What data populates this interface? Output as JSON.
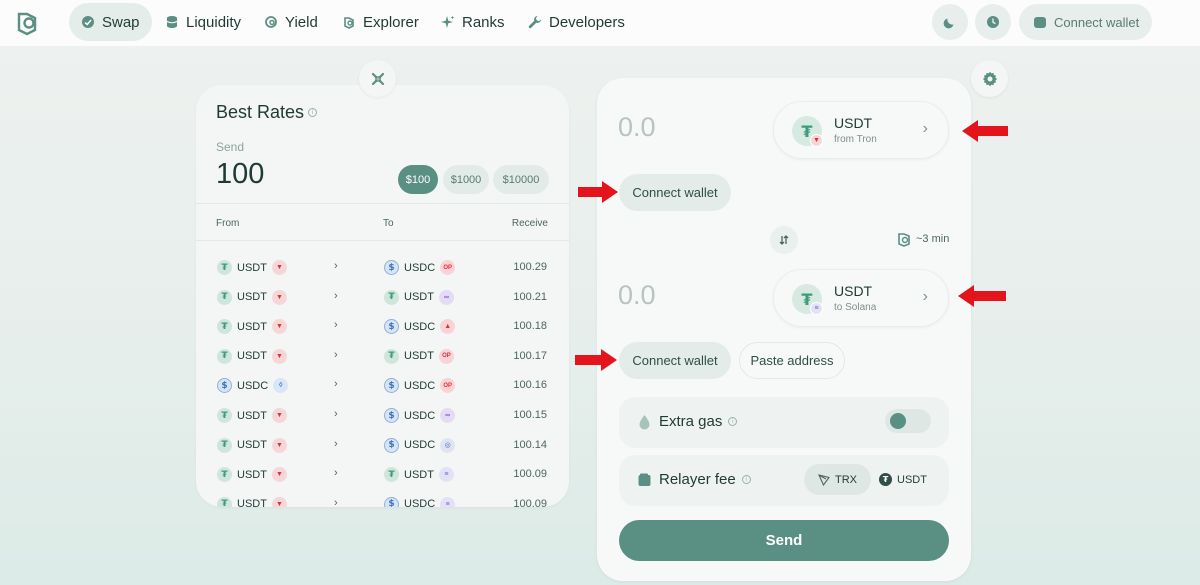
{
  "nav": {
    "items": [
      {
        "label": "Swap",
        "icon": "swap-icon"
      },
      {
        "label": "Liquidity",
        "icon": "database-icon"
      },
      {
        "label": "Yield",
        "icon": "yield-icon"
      },
      {
        "label": "Explorer",
        "icon": "explorer-icon"
      },
      {
        "label": "Ranks",
        "icon": "sparkle-icon"
      },
      {
        "label": "Developers",
        "icon": "wrench-icon"
      }
    ],
    "connect_wallet": "Connect wallet"
  },
  "rates": {
    "title": "Best Rates",
    "send_label": "Send",
    "send_amount": "100",
    "presets": [
      "$100",
      "$1000",
      "$10000"
    ],
    "columns": {
      "from": "From",
      "to": "To",
      "receive": "Receive"
    },
    "rows": [
      {
        "from": "USDT",
        "from_chain": "tron",
        "to": "USDC",
        "to_chain": "op",
        "receive": "100.29"
      },
      {
        "from": "USDT",
        "from_chain": "tron",
        "to": "USDT",
        "to_chain": "poly",
        "receive": "100.21"
      },
      {
        "from": "USDT",
        "from_chain": "tron",
        "to": "USDC",
        "to_chain": "avax",
        "receive": "100.18"
      },
      {
        "from": "USDT",
        "from_chain": "tron",
        "to": "USDT",
        "to_chain": "op",
        "receive": "100.17"
      },
      {
        "from": "USDC",
        "from_chain": "base",
        "to": "USDC",
        "to_chain": "op",
        "receive": "100.16"
      },
      {
        "from": "USDT",
        "from_chain": "tron",
        "to": "USDC",
        "to_chain": "poly",
        "receive": "100.15"
      },
      {
        "from": "USDT",
        "from_chain": "tron",
        "to": "USDC",
        "to_chain": "eth",
        "receive": "100.14"
      },
      {
        "from": "USDT",
        "from_chain": "tron",
        "to": "USDT",
        "to_chain": "sol",
        "receive": "100.09"
      },
      {
        "from": "USDT",
        "from_chain": "tron",
        "to": "USDC",
        "to_chain": "sol",
        "receive": "100.09"
      }
    ]
  },
  "swap": {
    "from_amount": "0.0",
    "from_token": {
      "symbol": "USDT",
      "sub": "from Tron"
    },
    "from_connect": "Connect wallet",
    "eta": "~3 min",
    "to_amount": "0.0",
    "to_token": {
      "symbol": "USDT",
      "sub": "to Solana"
    },
    "to_connect": "Connect wallet",
    "paste_address": "Paste address",
    "extra_gas": "Extra gas",
    "extra_gas_enabled": false,
    "relayer_fee": "Relayer fee",
    "fee_options": [
      "TRX",
      "USDT"
    ],
    "fee_selected": "TRX",
    "send": "Send"
  },
  "colors": {
    "accent": "#5a8f83",
    "arrow": "#e3141b",
    "tron": "#e0313b"
  }
}
